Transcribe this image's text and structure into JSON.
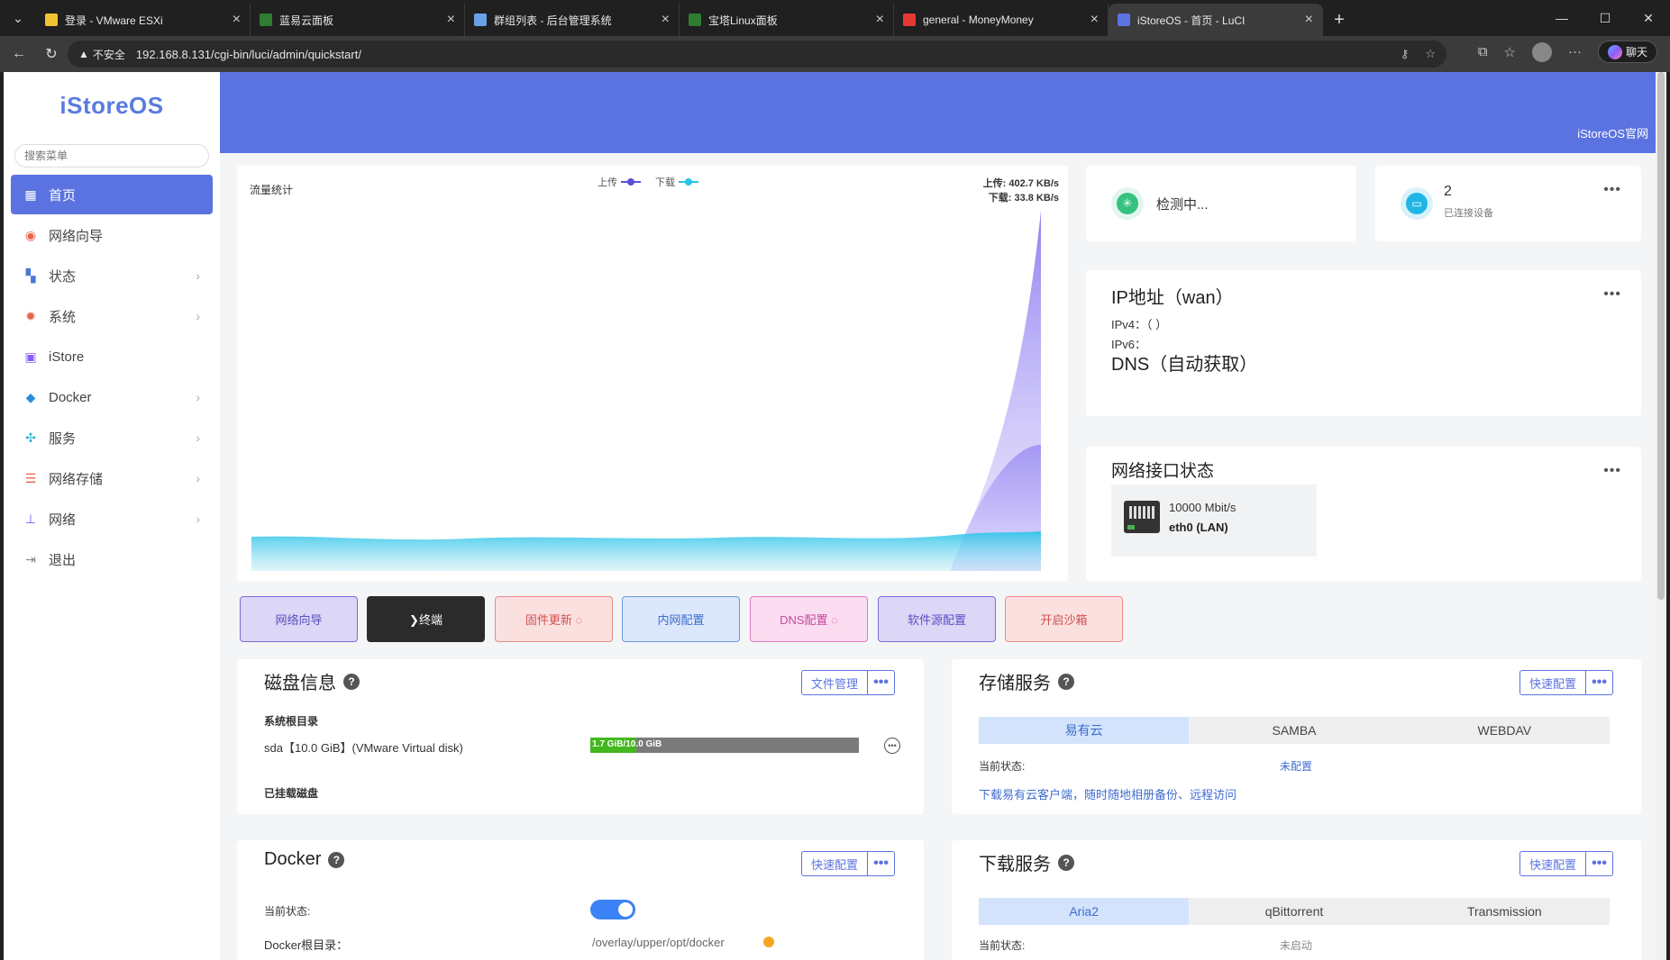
{
  "browser": {
    "tabs": [
      {
        "title": "登录 - VMware ESXi",
        "color": "#f1c232"
      },
      {
        "title": "蓝易云面板",
        "color": "#2e7d32"
      },
      {
        "title": "群组列表 - 后台管理系统",
        "color": "#6aa0e8"
      },
      {
        "title": "宝塔Linux面板",
        "color": "#2e7d32"
      },
      {
        "title": "general - MoneyMoney",
        "color": "#e53935"
      },
      {
        "title": "iStoreOS - 首页 - LuCI",
        "color": "#5b73e0"
      }
    ],
    "insecure_label": "不安全",
    "url": "192.168.8.131/cgi-bin/luci/admin/quickstart/",
    "chat_label": "聊天"
  },
  "sidebar": {
    "logo": "iStoreOS",
    "search_placeholder": "搜索菜单",
    "items": [
      {
        "label": "首页",
        "icon": "dashboard-icon",
        "color": "#ffffff"
      },
      {
        "label": "网络向导",
        "icon": "location-icon",
        "color": "#e8644c"
      },
      {
        "label": "状态",
        "icon": "grid-icon",
        "color": "#4a78d8"
      },
      {
        "label": "系统",
        "icon": "gear-icon",
        "color": "#e8644c"
      },
      {
        "label": "iStore",
        "icon": "store-icon",
        "color": "#8b5cf6"
      },
      {
        "label": "Docker",
        "icon": "docker-icon",
        "color": "#2b8fd6"
      },
      {
        "label": "服务",
        "icon": "services-icon",
        "color": "#2bb0d6"
      },
      {
        "label": "网络存储",
        "icon": "database-icon",
        "color": "#e8644c"
      },
      {
        "label": "网络",
        "icon": "network-icon",
        "color": "#8b5cf6"
      },
      {
        "label": "退出",
        "icon": "logout-icon",
        "color": "#888888"
      }
    ]
  },
  "banner": {
    "link": "iStoreOS官网"
  },
  "traffic": {
    "title": "流量统计",
    "legend_up": "上传",
    "legend_down": "下载",
    "upload_rate": "上传: 402.7 KB/s",
    "download_rate": "下载: 33.8 KB/s",
    "colors": {
      "upload": "#8b7cf0",
      "download": "#29c3e8"
    }
  },
  "detect_card": {
    "label": "检测中..."
  },
  "devices_card": {
    "count": "2",
    "label": "已连接设备"
  },
  "ip_card": {
    "title": "IP地址（wan）",
    "ipv4": "IPv4：（ ）",
    "ipv6": "IPv6：",
    "dns": "DNS（自动获取）"
  },
  "interface_card": {
    "title": "网络接口状态",
    "speed": "10000 Mbit/s",
    "name": "eth0 (LAN)"
  },
  "quick_buttons": [
    {
      "label": "网络向导",
      "bg": "#dcd6f7",
      "border": "#7b6fd6",
      "color": "#5b4fc0"
    },
    {
      "label": "❯终端",
      "bg": "#2b2b2b",
      "border": "#2b2b2b",
      "color": "#ffffff"
    },
    {
      "label": "固件更新 ◌",
      "bg": "#fbe0e0",
      "border": "#e88a8a",
      "color": "#d05050"
    },
    {
      "label": "内网配置",
      "bg": "#dbe8fb",
      "border": "#6b9ae0",
      "color": "#3f6ccf"
    },
    {
      "label": "DNS配置 ◌",
      "bg": "#fbdcf0",
      "border": "#e07ac0",
      "color": "#c44aa0"
    },
    {
      "label": "软件源配置",
      "bg": "#dcd6f7",
      "border": "#7b6fd6",
      "color": "#5b4fc0"
    },
    {
      "label": "开启沙箱",
      "bg": "#fbe0e0",
      "border": "#e88a8a",
      "color": "#d05050"
    }
  ],
  "disk_panel": {
    "title": "磁盘信息",
    "action": "文件管理",
    "more": "•••",
    "root_label": "系统根目录",
    "disk": "sda【10.0 GiB】(VMware Virtual disk)",
    "usage_text": "1.7 GiB/10.0 GiB",
    "usage_fraction": 0.17,
    "mounted_label": "已挂载磁盘"
  },
  "storage_panel": {
    "title": "存储服务",
    "action": "快速配置",
    "more": "•••",
    "tabs": [
      "易有云",
      "SAMBA",
      "WEBDAV"
    ],
    "status_label": "当前状态:",
    "status_value": "未配置",
    "link": "下载易有云客户端，随时随地相册备份、远程访问"
  },
  "docker_panel": {
    "title": "Docker",
    "action": "快速配置",
    "more": "•••",
    "status_label": "当前状态:",
    "root_label": "Docker根目录：",
    "root_value": "/overlay/upper/opt/docker"
  },
  "download_panel": {
    "title": "下载服务",
    "action": "快速配置",
    "more": "•••",
    "tabs": [
      "Aria2",
      "qBittorrent",
      "Transmission"
    ],
    "status_label": "当前状态:",
    "status_value": "未启动"
  }
}
